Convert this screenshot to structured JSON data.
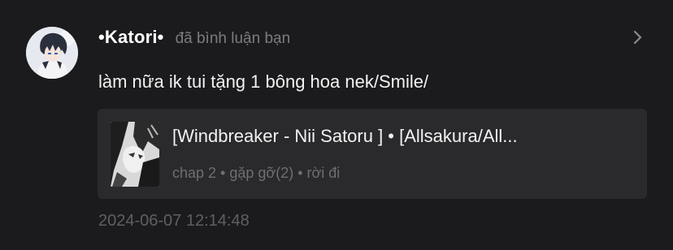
{
  "notification": {
    "user": {
      "name": "•Katori•",
      "avatar_icon": "anime-avatar-icon"
    },
    "action_text": "đã bình luận bạn",
    "comment": "làm nữa ik tui tặng 1 bông hoa nek/Smile/",
    "story": {
      "title": "[Windbreaker - Nii Satoru ] • [Allsakura/All...",
      "chapter": "chap 2 • gặp gỡ(2) • rời đi",
      "thumbnail_icon": "manga-cover-icon"
    },
    "timestamp": "2024-06-07 12:14:48"
  },
  "colors": {
    "background": "#1b1b1d",
    "card": "#2a2a2c",
    "muted_text": "#7c7c80",
    "timestamp_text": "#5f5f64"
  }
}
